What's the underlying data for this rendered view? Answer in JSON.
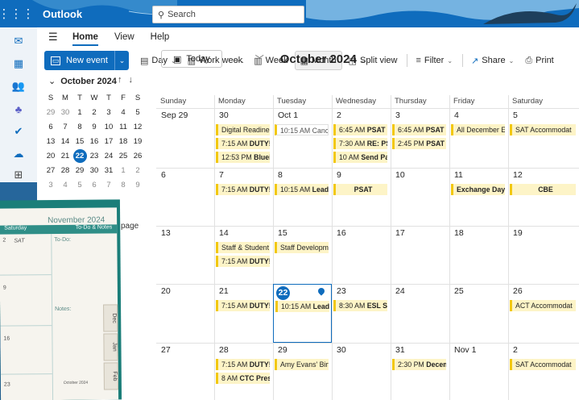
{
  "app": {
    "name": "Outlook",
    "search_placeholder": "Search"
  },
  "menu": {
    "items": [
      "Home",
      "View",
      "Help"
    ],
    "active": "Home"
  },
  "toolbar": {
    "new_event": "New event",
    "day": "Day",
    "work_week": "Work week",
    "week": "Week",
    "month": "Month",
    "split_view": "Split view",
    "filter": "Filter",
    "share": "Share",
    "print": "Print"
  },
  "mini_calendar": {
    "title": "October 2024",
    "weekdays": [
      "S",
      "M",
      "T",
      "W",
      "T",
      "F",
      "S"
    ],
    "weeks": [
      [
        "29",
        "30",
        "1",
        "2",
        "3",
        "4",
        "5"
      ],
      [
        "6",
        "7",
        "8",
        "9",
        "10",
        "11",
        "12"
      ],
      [
        "13",
        "14",
        "15",
        "16",
        "17",
        "18",
        "19"
      ],
      [
        "20",
        "21",
        "22",
        "23",
        "24",
        "25",
        "26"
      ],
      [
        "27",
        "28",
        "29",
        "30",
        "31",
        "1",
        "2"
      ],
      [
        "3",
        "4",
        "5",
        "6",
        "7",
        "8",
        "9"
      ]
    ],
    "today": "22",
    "goto_label": "page"
  },
  "calendar": {
    "today_label": "Today",
    "title": "October 2024",
    "weekdays": [
      "Sunday",
      "Monday",
      "Tuesday",
      "Wednesday",
      "Thursday",
      "Friday",
      "Saturday"
    ],
    "weeks": [
      [
        {
          "date": "Sep 29",
          "events": []
        },
        {
          "date": "30",
          "events": [
            {
              "t": "",
              "l": "Digital Readiness",
              "style": "plain"
            },
            {
              "t": "7:15 AM",
              "l": "DUTY!⟲",
              "style": "bold"
            },
            {
              "t": "12:53 PM",
              "l": "Blueitt D",
              "style": "bold"
            }
          ]
        },
        {
          "date": "Oct 1",
          "events": [
            {
              "t": "10:15 AM",
              "l": "Canc⟲",
              "style": "out"
            }
          ]
        },
        {
          "date": "2",
          "events": [
            {
              "t": "6:45 AM",
              "l": "PSAT Trai",
              "style": "bold"
            },
            {
              "t": "7:30 AM",
              "l": "RE: PSAT",
              "style": "bold"
            },
            {
              "t": "10 AM",
              "l": "Send Parer",
              "style": "bold"
            }
          ]
        },
        {
          "date": "3",
          "events": [
            {
              "t": "6:45 AM",
              "l": "PSAT Trai",
              "style": "bold"
            },
            {
              "t": "2:45 PM",
              "l": "PSAT Trai",
              "style": "bold"
            }
          ]
        },
        {
          "date": "4",
          "events": [
            {
              "t": "",
              "l": "All December Elig",
              "style": "plain"
            }
          ]
        },
        {
          "date": "5",
          "events": [
            {
              "t": "",
              "l": "SAT Accommodat",
              "style": "plain"
            }
          ]
        }
      ],
      [
        {
          "date": "6",
          "events": []
        },
        {
          "date": "7",
          "events": [
            {
              "t": "7:15 AM",
              "l": "DUTY!⟲",
              "style": "bold"
            }
          ]
        },
        {
          "date": "8",
          "events": [
            {
              "t": "10:15 AM",
              "l": "Lead⟲",
              "style": "bold"
            }
          ]
        },
        {
          "date": "9",
          "events": [
            {
              "t": "",
              "l": "PSAT",
              "style": "center"
            }
          ]
        },
        {
          "date": "10",
          "events": []
        },
        {
          "date": "11",
          "events": [
            {
              "t": "",
              "l": "Exchange Day",
              "style": "center"
            }
          ]
        },
        {
          "date": "12",
          "events": [
            {
              "t": "",
              "l": "CBE",
              "style": "center"
            }
          ]
        }
      ],
      [
        {
          "date": "13",
          "events": []
        },
        {
          "date": "14",
          "events": [
            {
              "t": "",
              "l": "Staff & Student H",
              "style": "plain"
            },
            {
              "t": "7:15 AM",
              "l": "DUTY!⟲",
              "style": "bold"
            }
          ]
        },
        {
          "date": "15",
          "events": [
            {
              "t": "",
              "l": "Staff Developmen",
              "style": "plain"
            }
          ]
        },
        {
          "date": "16",
          "events": []
        },
        {
          "date": "17",
          "events": []
        },
        {
          "date": "18",
          "events": []
        },
        {
          "date": "19",
          "events": []
        }
      ],
      [
        {
          "date": "20",
          "events": []
        },
        {
          "date": "21",
          "events": [
            {
              "t": "7:15 AM",
              "l": "DUTY!⟲",
              "style": "bold"
            }
          ]
        },
        {
          "date": "22",
          "events": [
            {
              "t": "10:15 AM",
              "l": "Lead⟲",
              "style": "bold"
            }
          ],
          "today": true
        },
        {
          "date": "23",
          "events": [
            {
              "t": "8:30 AM",
              "l": "ESL STAA",
              "style": "bold"
            }
          ]
        },
        {
          "date": "24",
          "events": []
        },
        {
          "date": "25",
          "events": []
        },
        {
          "date": "26",
          "events": [
            {
              "t": "",
              "l": "ACT Accommodat",
              "style": "plain"
            }
          ]
        }
      ],
      [
        {
          "date": "27",
          "events": []
        },
        {
          "date": "28",
          "events": [
            {
              "t": "7:15 AM",
              "l": "DUTY!⟲",
              "style": "bold"
            },
            {
              "t": "8 AM",
              "l": "CTC Present",
              "style": "bold"
            }
          ]
        },
        {
          "date": "29",
          "events": [
            {
              "t": "",
              "l": "Amy Evans' Birthc",
              "style": "plain"
            }
          ]
        },
        {
          "date": "30",
          "events": []
        },
        {
          "date": "31",
          "events": [
            {
              "t": "2:30 PM",
              "l": "Decembe",
              "style": "bold"
            }
          ]
        },
        {
          "date": "Nov 1",
          "events": []
        },
        {
          "date": "2",
          "events": [
            {
              "t": "",
              "l": "SAT Accommodat",
              "style": "plain"
            }
          ]
        }
      ]
    ]
  },
  "planner": {
    "month": "November 2024",
    "col1": "Saturday",
    "col2": "To-Do & Notes",
    "day2": "2",
    "sat": "SAT",
    "todo": "To-Do:",
    "notes": "Notes:",
    "n9": "9",
    "n16": "16",
    "n23": "23",
    "tabs": [
      "Dec",
      "Jan",
      "Feb"
    ],
    "mini_title": "October 2024"
  }
}
